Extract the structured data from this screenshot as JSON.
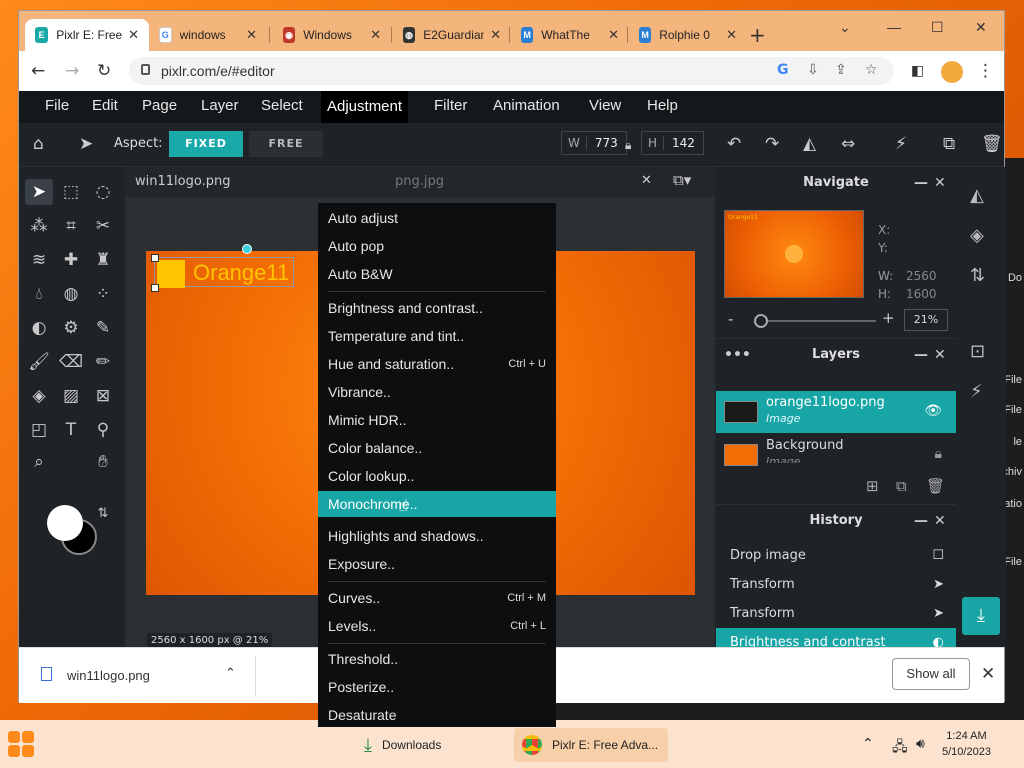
{
  "browser": {
    "tabs": [
      {
        "label": "Pixlr E: Free",
        "active": true
      },
      {
        "label": "windows"
      },
      {
        "label": "Windows"
      },
      {
        "label": "E2Guardian"
      },
      {
        "label": "WhatThe"
      },
      {
        "label": "Rolphie 0"
      }
    ],
    "new_tab": "+",
    "url": "pixlr.com/e/#editor"
  },
  "app": {
    "menu": [
      "File",
      "Edit",
      "Page",
      "Layer",
      "Select",
      "Adjustment",
      "Filter",
      "Animation",
      "View",
      "Help"
    ],
    "options": {
      "aspect_label": "Aspect:",
      "fixed_label": "FIXED",
      "free_label": "FREE",
      "w_label": "W",
      "w_value": "773",
      "h_label": "H",
      "h_value": "142"
    },
    "document": {
      "tab_name": "win11logo.png",
      "tab_name_2": "png.jpg",
      "logo_text": "Orange11",
      "status": "2560 x 1600 px @ 21%"
    },
    "adjustment_menu": [
      {
        "label": "Auto adjust"
      },
      {
        "label": "Auto pop"
      },
      {
        "label": "Auto B&W"
      },
      {
        "label": "Brightness and contrast.."
      },
      {
        "label": "Temperature and tint.."
      },
      {
        "label": "Hue and saturation..",
        "shortcut": "Ctrl + U"
      },
      {
        "label": "Vibrance.."
      },
      {
        "label": "Mimic HDR.."
      },
      {
        "label": "Color balance.."
      },
      {
        "label": "Color lookup.."
      },
      {
        "label": "Monochrome..",
        "highlighted": true
      },
      {
        "label": "Highlights and shadows.."
      },
      {
        "label": "Exposure.."
      },
      {
        "label": "Curves..",
        "shortcut": "Ctrl + M"
      },
      {
        "label": "Levels..",
        "shortcut": "Ctrl + L"
      },
      {
        "label": "Threshold.."
      },
      {
        "label": "Posterize.."
      },
      {
        "label": "Desaturate"
      }
    ],
    "navigate": {
      "title": "Navigate",
      "x_label": "X:",
      "y_label": "Y:",
      "w_label": "W:",
      "w_value": "2560",
      "h_label": "H:",
      "h_value": "1600",
      "zoom": "21%",
      "minus": "-",
      "plus": "+"
    },
    "layers": {
      "title": "Layers",
      "items": [
        {
          "name": "orange11logo.png",
          "type": "Image",
          "selected": true
        },
        {
          "name": "Background",
          "type": "Image"
        }
      ]
    },
    "history": {
      "title": "History",
      "items": [
        {
          "label": "Drop image"
        },
        {
          "label": "Transform"
        },
        {
          "label": "Transform"
        },
        {
          "label": "Brightness and contrast",
          "selected": true
        }
      ]
    }
  },
  "downloads": {
    "file_name": "win11logo.png",
    "show_all": "Show all"
  },
  "taskbar": {
    "downloads_label": "Downloads",
    "chrome_label": "Pixlr E: Free Adva...",
    "time": "1:24 AM",
    "date": "5/10/2023"
  },
  "background_window": {
    "side_text": [
      "Do",
      "File",
      "File",
      "le",
      "rchiv",
      "catio",
      "File"
    ]
  },
  "colors": {
    "accent": "#18a5a5",
    "app_bg": "#1f2327",
    "tabbar": "#f4b57d"
  }
}
